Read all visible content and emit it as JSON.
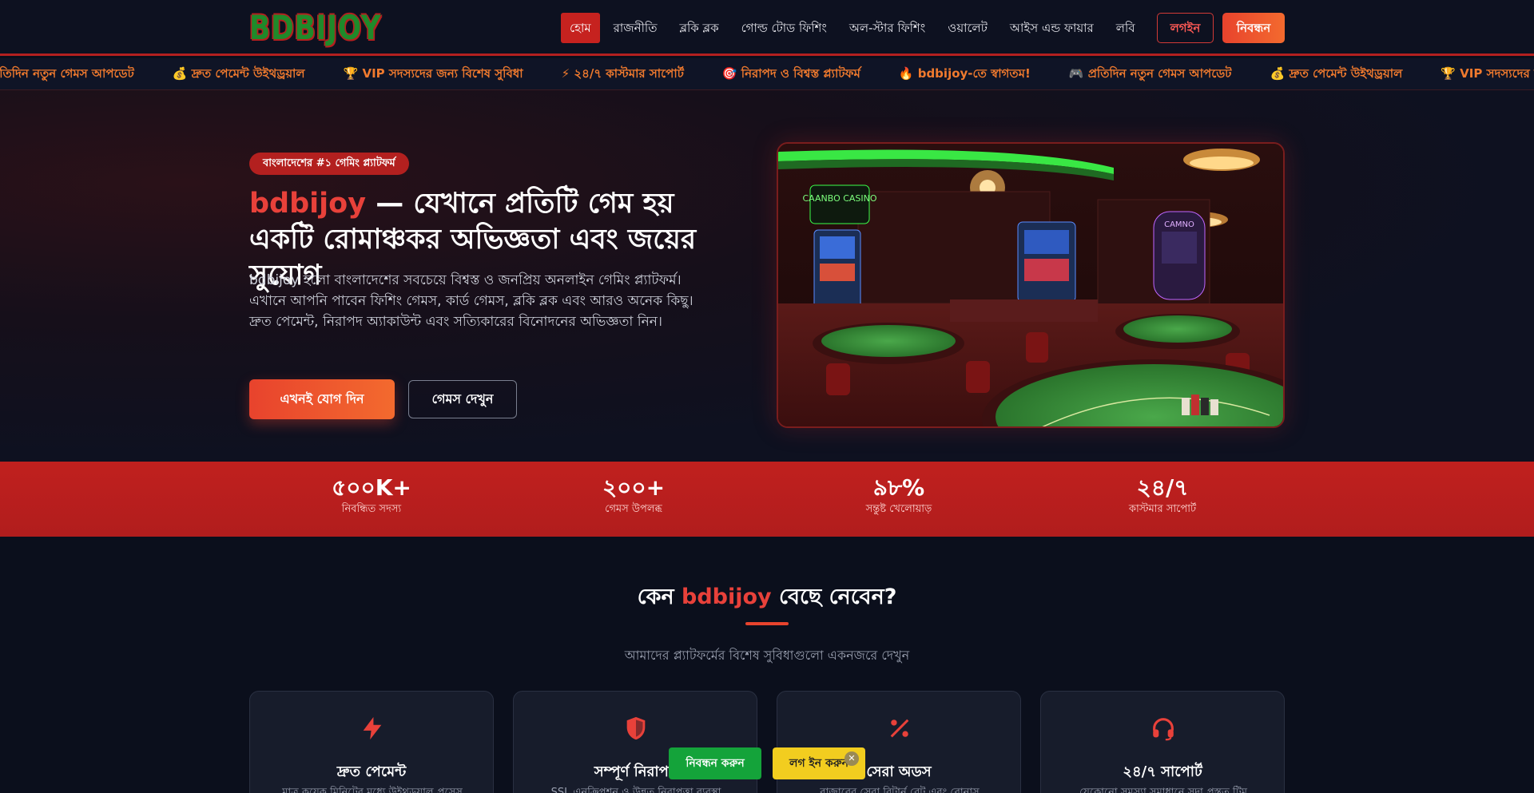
{
  "header": {
    "logo": "BDBIJOY",
    "nav": [
      "হোম",
      "রাজনীতি",
      "ব্লকি ব্লক",
      "গোল্ড টোড ফিশিং",
      "অল-স্টার ফিশিং",
      "ওয়ালেট",
      "আইস এন্ড ফায়ার",
      "লবি"
    ],
    "login_label": "লগইন",
    "register_label": "নিবন্ধন"
  },
  "ticker": [
    "প্রতিদিন নতুন গেমস আপডেট",
    "💰 দ্রুত পেমেন্ট উইথড্রয়াল",
    "🏆 VIP সদস্যদের জন্য বিশেষ সুবিধা",
    "⚡ ২৪/৭ কাস্টমার সাপোর্ট",
    "🎯 নিরাপদ ও বিশ্বস্ত প্ল্যাটফর্ম",
    "🔥 bdbijoy-তে স্বাগতম!",
    "🎮 প্রতিদিন নতুন গেমস আপডেট",
    "💰 দ্রুত পেমেন্ট উইথড্রয়াল",
    "🏆 VIP সদস্যদের জন্য বিশেষ সুবিধা"
  ],
  "hero": {
    "badge": "বাংলাদেশের #১ গেমিং প্ল্যাটফর্ম",
    "title_brand": "bdbijoy",
    "title_rest": " — যেখানে প্রতিটি গেম হয় একটি রোমাঞ্চকর অভিজ্ঞতা এবং জয়ের সুযোগ",
    "description": "bdbijoy হলো বাংলাদেশের সবচেয়ে বিশ্বস্ত ও জনপ্রিয় অনলাইন গেমিং প্ল্যাটফর্ম। এখানে আপনি পাবেন ফিশিং গেমস, কার্ড গেমস, ব্লকি ব্লক এবং আরও অনেক কিছু। দ্রুত পেমেন্ট, নিরাপদ অ্যাকাউন্ট এবং সত্যিকারের বিনোদনের অভিজ্ঞতা নিন।",
    "join_label": "এখনই যোগ দিন",
    "games_label": "গেমস দেখুন",
    "image_sign_1": "CAANBO CASINO",
    "image_sign_2": "CAMNO"
  },
  "stats": [
    {
      "value": "৫০০K+",
      "label": "নিবন্ধিত সদস্য"
    },
    {
      "value": "২০০+",
      "label": "গেমস উপলব্ধ"
    },
    {
      "value": "৯৮%",
      "label": "সন্তুষ্ট খেলোয়াড়"
    },
    {
      "value": "২৪/৭",
      "label": "কাস্টমার সাপোর্ট"
    }
  ],
  "features": {
    "title_prefix": "কেন ",
    "title_brand": "bdbijoy",
    "title_suffix": " বেছে নেবেন?",
    "subtitle": "আমাদের প্ল্যাটফর্মের বিশেষ সুবিধাগুলো একনজরে দেখুন",
    "cards": [
      {
        "icon": "lightning-icon",
        "title": "দ্রুত পেমেন্ট",
        "desc": "মাত্র কয়েক মিনিটের মধ্যে উইথড্রয়াল প্রসেস"
      },
      {
        "icon": "shield-icon",
        "title": "সম্পূর্ণ নিরাপদ",
        "desc": "SSL এনক্রিপশন ও উন্নত নিরাপত্তা ব্যবস্থা"
      },
      {
        "icon": "percent-icon",
        "title": "সেরা অডস",
        "desc": "বাজারের সেরা রিটার্ন রেট এবং বোনাস"
      },
      {
        "icon": "headset-icon",
        "title": "২৪/৭ সাপোর্ট",
        "desc": "যেকোনো সমস্যা সমাধানে সদা প্রস্তুত টিম"
      }
    ]
  },
  "floating": {
    "register_label": "নিবন্ধন করুন",
    "login_label": "লগ ইন করুন",
    "close_label": "✕"
  },
  "colors": {
    "accent": "#c6221f",
    "accent_orange": "#f36a2e",
    "background": "#0b0f1c",
    "card": "#171c2b",
    "green_cta": "#14a33a",
    "yellow_cta": "#f2cd1f"
  }
}
